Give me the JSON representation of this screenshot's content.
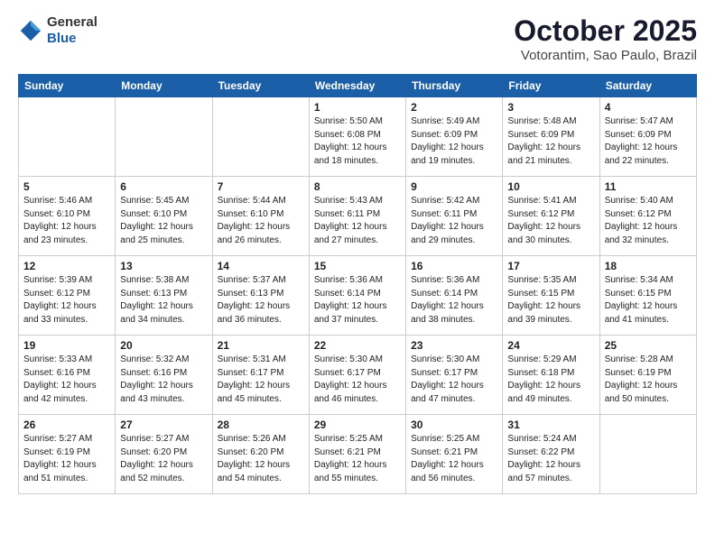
{
  "header": {
    "logo_general": "General",
    "logo_blue": "Blue",
    "month_title": "October 2025",
    "location": "Votorantim, Sao Paulo, Brazil"
  },
  "days_of_week": [
    "Sunday",
    "Monday",
    "Tuesday",
    "Wednesday",
    "Thursday",
    "Friday",
    "Saturday"
  ],
  "weeks": [
    [
      {
        "day": "",
        "detail": ""
      },
      {
        "day": "",
        "detail": ""
      },
      {
        "day": "",
        "detail": ""
      },
      {
        "day": "1",
        "detail": "Sunrise: 5:50 AM\nSunset: 6:08 PM\nDaylight: 12 hours\nand 18 minutes."
      },
      {
        "day": "2",
        "detail": "Sunrise: 5:49 AM\nSunset: 6:09 PM\nDaylight: 12 hours\nand 19 minutes."
      },
      {
        "day": "3",
        "detail": "Sunrise: 5:48 AM\nSunset: 6:09 PM\nDaylight: 12 hours\nand 21 minutes."
      },
      {
        "day": "4",
        "detail": "Sunrise: 5:47 AM\nSunset: 6:09 PM\nDaylight: 12 hours\nand 22 minutes."
      }
    ],
    [
      {
        "day": "5",
        "detail": "Sunrise: 5:46 AM\nSunset: 6:10 PM\nDaylight: 12 hours\nand 23 minutes."
      },
      {
        "day": "6",
        "detail": "Sunrise: 5:45 AM\nSunset: 6:10 PM\nDaylight: 12 hours\nand 25 minutes."
      },
      {
        "day": "7",
        "detail": "Sunrise: 5:44 AM\nSunset: 6:10 PM\nDaylight: 12 hours\nand 26 minutes."
      },
      {
        "day": "8",
        "detail": "Sunrise: 5:43 AM\nSunset: 6:11 PM\nDaylight: 12 hours\nand 27 minutes."
      },
      {
        "day": "9",
        "detail": "Sunrise: 5:42 AM\nSunset: 6:11 PM\nDaylight: 12 hours\nand 29 minutes."
      },
      {
        "day": "10",
        "detail": "Sunrise: 5:41 AM\nSunset: 6:12 PM\nDaylight: 12 hours\nand 30 minutes."
      },
      {
        "day": "11",
        "detail": "Sunrise: 5:40 AM\nSunset: 6:12 PM\nDaylight: 12 hours\nand 32 minutes."
      }
    ],
    [
      {
        "day": "12",
        "detail": "Sunrise: 5:39 AM\nSunset: 6:12 PM\nDaylight: 12 hours\nand 33 minutes."
      },
      {
        "day": "13",
        "detail": "Sunrise: 5:38 AM\nSunset: 6:13 PM\nDaylight: 12 hours\nand 34 minutes."
      },
      {
        "day": "14",
        "detail": "Sunrise: 5:37 AM\nSunset: 6:13 PM\nDaylight: 12 hours\nand 36 minutes."
      },
      {
        "day": "15",
        "detail": "Sunrise: 5:36 AM\nSunset: 6:14 PM\nDaylight: 12 hours\nand 37 minutes."
      },
      {
        "day": "16",
        "detail": "Sunrise: 5:36 AM\nSunset: 6:14 PM\nDaylight: 12 hours\nand 38 minutes."
      },
      {
        "day": "17",
        "detail": "Sunrise: 5:35 AM\nSunset: 6:15 PM\nDaylight: 12 hours\nand 39 minutes."
      },
      {
        "day": "18",
        "detail": "Sunrise: 5:34 AM\nSunset: 6:15 PM\nDaylight: 12 hours\nand 41 minutes."
      }
    ],
    [
      {
        "day": "19",
        "detail": "Sunrise: 5:33 AM\nSunset: 6:16 PM\nDaylight: 12 hours\nand 42 minutes."
      },
      {
        "day": "20",
        "detail": "Sunrise: 5:32 AM\nSunset: 6:16 PM\nDaylight: 12 hours\nand 43 minutes."
      },
      {
        "day": "21",
        "detail": "Sunrise: 5:31 AM\nSunset: 6:17 PM\nDaylight: 12 hours\nand 45 minutes."
      },
      {
        "day": "22",
        "detail": "Sunrise: 5:30 AM\nSunset: 6:17 PM\nDaylight: 12 hours\nand 46 minutes."
      },
      {
        "day": "23",
        "detail": "Sunrise: 5:30 AM\nSunset: 6:17 PM\nDaylight: 12 hours\nand 47 minutes."
      },
      {
        "day": "24",
        "detail": "Sunrise: 5:29 AM\nSunset: 6:18 PM\nDaylight: 12 hours\nand 49 minutes."
      },
      {
        "day": "25",
        "detail": "Sunrise: 5:28 AM\nSunset: 6:19 PM\nDaylight: 12 hours\nand 50 minutes."
      }
    ],
    [
      {
        "day": "26",
        "detail": "Sunrise: 5:27 AM\nSunset: 6:19 PM\nDaylight: 12 hours\nand 51 minutes."
      },
      {
        "day": "27",
        "detail": "Sunrise: 5:27 AM\nSunset: 6:20 PM\nDaylight: 12 hours\nand 52 minutes."
      },
      {
        "day": "28",
        "detail": "Sunrise: 5:26 AM\nSunset: 6:20 PM\nDaylight: 12 hours\nand 54 minutes."
      },
      {
        "day": "29",
        "detail": "Sunrise: 5:25 AM\nSunset: 6:21 PM\nDaylight: 12 hours\nand 55 minutes."
      },
      {
        "day": "30",
        "detail": "Sunrise: 5:25 AM\nSunset: 6:21 PM\nDaylight: 12 hours\nand 56 minutes."
      },
      {
        "day": "31",
        "detail": "Sunrise: 5:24 AM\nSunset: 6:22 PM\nDaylight: 12 hours\nand 57 minutes."
      },
      {
        "day": "",
        "detail": ""
      }
    ]
  ]
}
